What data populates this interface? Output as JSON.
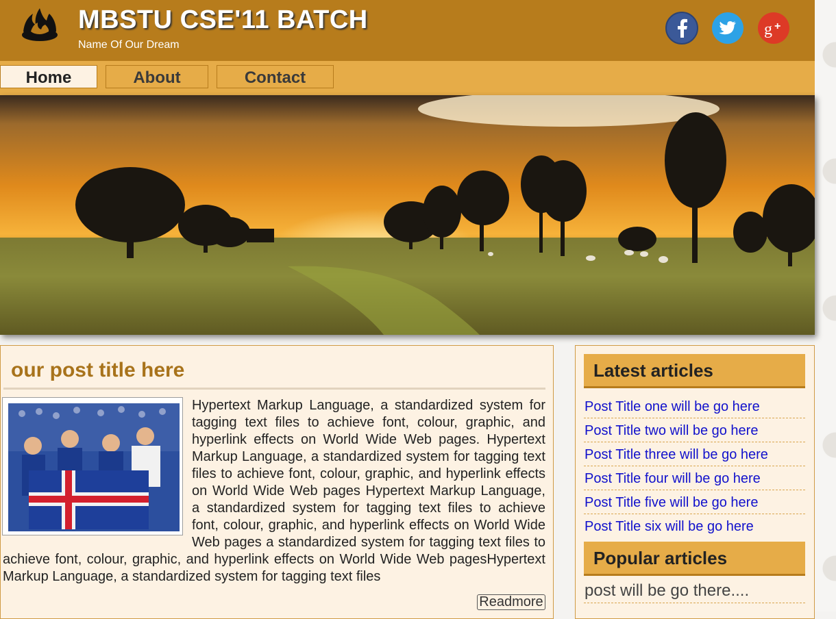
{
  "header": {
    "title": "MBSTU CSE'11 BATCH",
    "subtitle": "Name Of Our Dream",
    "social": [
      {
        "name": "facebook",
        "icon": "facebook-icon",
        "glyph": "f",
        "color": "#3b5998"
      },
      {
        "name": "twitter",
        "icon": "twitter-icon",
        "color": "#2da2e6"
      },
      {
        "name": "google-plus",
        "icon": "google-plus-icon",
        "glyph": "g+",
        "color": "#dd3a26"
      }
    ]
  },
  "nav": {
    "items": [
      {
        "label": "Home",
        "active": true
      },
      {
        "label": "About",
        "active": false
      },
      {
        "label": "Contact",
        "active": false
      }
    ]
  },
  "banner": {
    "image": "sunset-field-photo"
  },
  "post": {
    "title": "our post title here",
    "image": "team-with-flag-photo",
    "body": "Hypertext Markup Language, a standardized system for tagging text files to achieve font, colour, graphic, and hyperlink effects on World Wide Web pages. Hypertext Markup Language, a standardized system for tagging text files to achieve font, colour, graphic, and hyperlink effects on World Wide Web pages Hypertext Markup Language, a standardized system for tagging text files to achieve font, colour, graphic, and hyperlink effects on World Wide Web pages a standardized system for tagging text files to achieve font, colour, graphic, and hyperlink effects on World Wide Web pagesHypertext Markup Language, a standardized system for tagging text files",
    "readmore": "Readmore"
  },
  "sidebar": {
    "latest_title": "Latest articles",
    "latest": [
      "Post Title one will be go here",
      "Post Title two will be go here",
      "Post Title three will be go here",
      "Post Title four will be go here",
      "Post Title five will be go here",
      "Post Title six will be go here"
    ],
    "popular_title": "Popular articles",
    "popular_text": "post will be go there...."
  },
  "colors": {
    "header_bg": "#b77c1c",
    "nav_bg": "#e6ac48",
    "content_bg": "#fdf2e3",
    "title_accent": "#a8731b",
    "link": "#1111cc"
  }
}
